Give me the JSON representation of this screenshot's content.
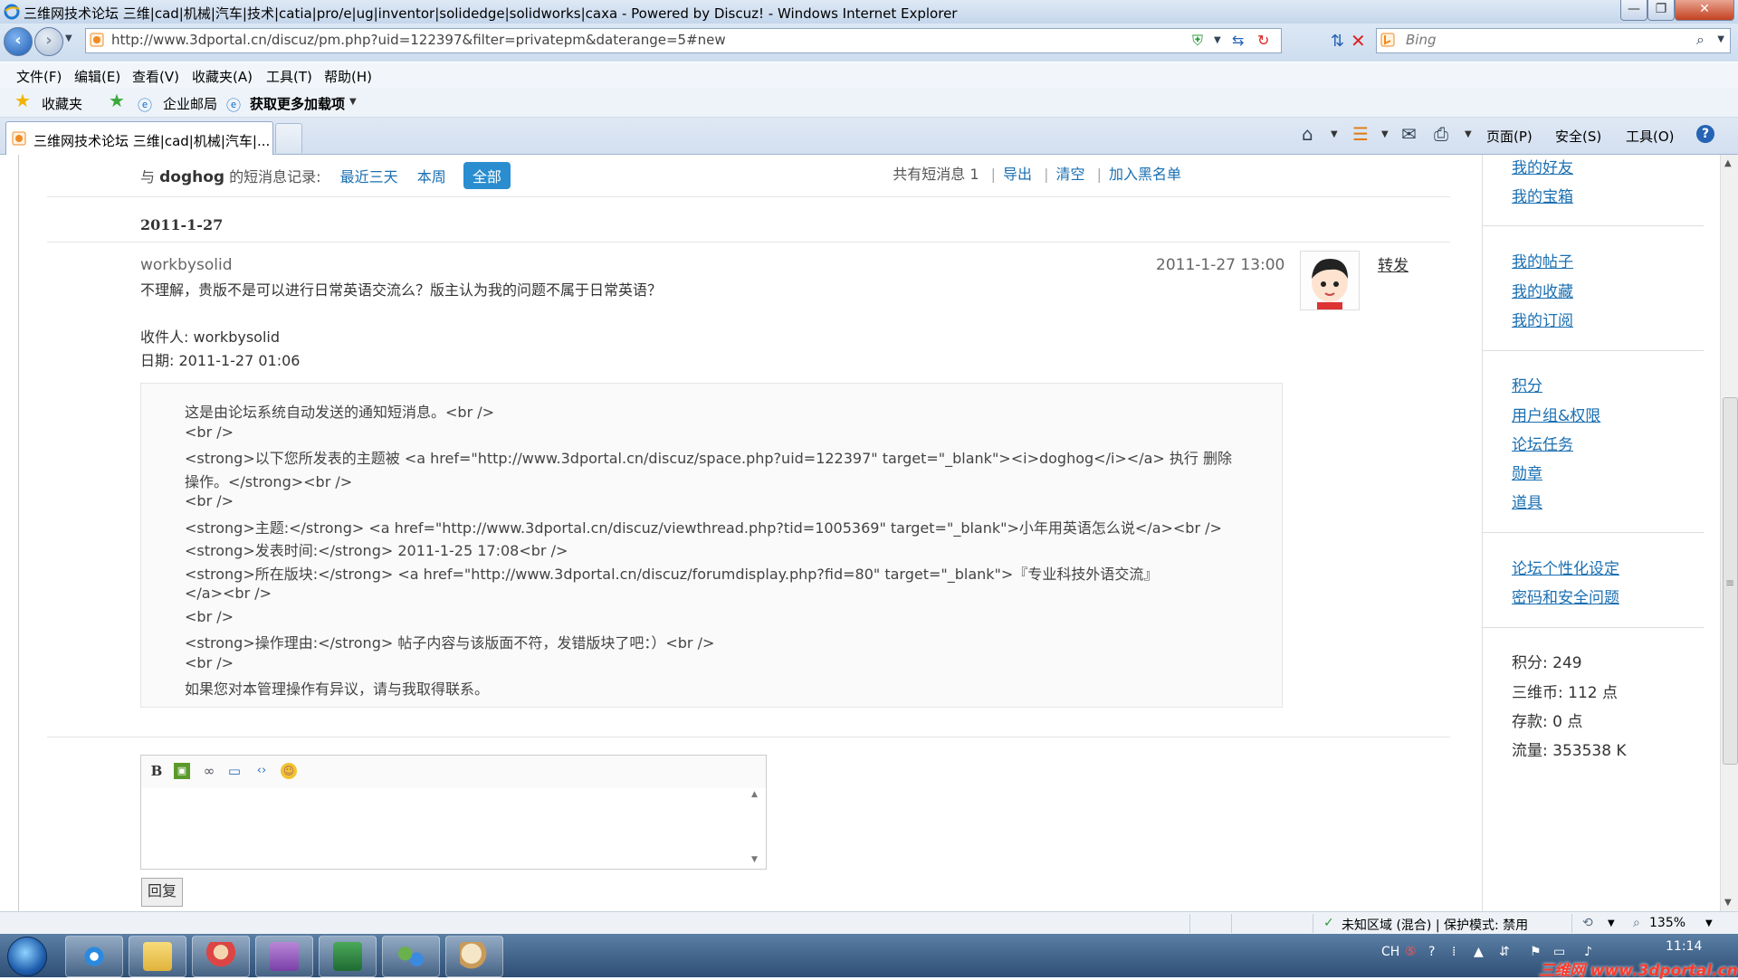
{
  "window": {
    "title": "三维网技术论坛 三维|cad|机械|汽车|技术|catia|pro/e|ug|inventor|solidedge|solidworks|caxa - Powered by Discuz! - Windows Internet Explorer",
    "minimize": "—",
    "maximize": "❐",
    "close": "✕"
  },
  "address": {
    "url": "http://www.3dportal.cn/discuz/pm.php?uid=122397&filter=privatepm&daterange=5#new",
    "search_placeholder": "Bing"
  },
  "menu": [
    "文件(F)",
    "编辑(E)",
    "查看(V)",
    "收藏夹(A)",
    "工具(T)",
    "帮助(H)"
  ],
  "favorites": {
    "favorites_label": "收藏夹",
    "item1": "企业邮局",
    "item2": "获取更多加载项"
  },
  "tab": {
    "title": "三维网技术论坛 三维|cad|机械|汽车|..."
  },
  "command_bar": {
    "page": "页面(P)",
    "safety": "安全(S)",
    "tools": "工具(O)",
    "help": "?"
  },
  "pm": {
    "prefix": "与",
    "user": "doghog",
    "suffix": "的短消息记录:",
    "filter_3days": "最近三天",
    "filter_week": "本周",
    "filter_all": "全部",
    "count_label": "共有短消息",
    "count": "1",
    "export": "导出",
    "clear": "清空",
    "blacklist": "加入黑名单"
  },
  "message": {
    "date_heading": "2011-1-27",
    "sender": "workbysolid",
    "time": "2011-1-27 13:00",
    "forward": "转发",
    "body": "不理解，贵版不是可以进行日常英语交流么？版主认为我的问题不属于日常英语？",
    "recipient": "收件人: workbysolid",
    "date": "日期: 2011-1-27 01:06",
    "quote": [
      "这是由论坛系统自动发送的通知短消息。<br />",
      "<br />",
      "<strong>以下您所发表的主题被 <a href=\"http://www.3dportal.cn/discuz/space.php?uid=122397\" target=\"_blank\"><i>doghog</i></a> 执行 删除",
      "操作。</strong><br />",
      "<br />",
      "<strong>主题:</strong> <a href=\"http://www.3dportal.cn/discuz/viewthread.php?tid=1005369\" target=\"_blank\">小年用英语怎么说</a><br />",
      "<strong>发表时间:</strong> 2011-1-25 17:08<br />",
      "<strong>所在版块:</strong> <a href=\"http://www.3dportal.cn/discuz/forumdisplay.php?fid=80\" target=\"_blank\">『专业科技外语交流』",
      "</a><br />",
      "<br />",
      "<strong>操作理由:</strong> 帖子内容与该版面不符，发错版块了吧：）<br />",
      "<br />",
      "如果您对本管理操作有异议，请与我取得联系。"
    ]
  },
  "reply": {
    "button": "回复"
  },
  "sidebar": {
    "group1": [
      "我的好友",
      "我的宝箱"
    ],
    "group2": [
      "我的帖子",
      "我的收藏",
      "我的订阅"
    ],
    "group3": [
      "积分",
      "用户组&权限",
      "论坛任务",
      "勋章",
      "道具"
    ],
    "group4": [
      "论坛个性化设定",
      "密码和安全问题"
    ],
    "stats": [
      "积分: 249",
      "三维币: 112 点",
      "存款: 0 点",
      "流量: 353538 K"
    ]
  },
  "status": {
    "zone": "未知区域 (混合) | 保护模式: 禁用",
    "zoom": "135%"
  },
  "taskbar": {
    "lang": "CH",
    "time": "11:14",
    "watermark": "三维网 www.3dportal.cn"
  }
}
